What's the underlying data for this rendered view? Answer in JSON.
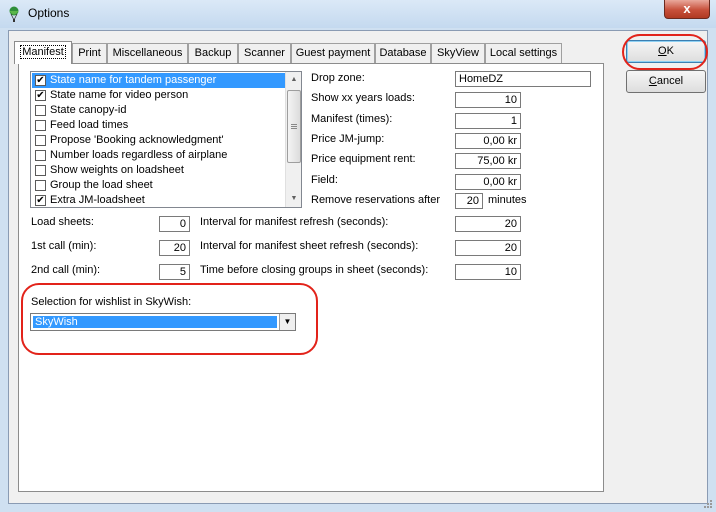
{
  "window": {
    "title": "Options",
    "close_glyph": "x"
  },
  "tabs": [
    {
      "label": "Manifest",
      "active": true
    },
    {
      "label": "Print"
    },
    {
      "label": "Miscellaneous"
    },
    {
      "label": "Backup"
    },
    {
      "label": "Scanner"
    },
    {
      "label": "Guest payment"
    },
    {
      "label": "Database"
    },
    {
      "label": "SkyView"
    },
    {
      "label": "Local settings"
    }
  ],
  "options_list": [
    {
      "label": "State name for tandem passenger",
      "checked": true,
      "selected": true
    },
    {
      "label": "State name for video person",
      "checked": true
    },
    {
      "label": "State canopy-id",
      "checked": false
    },
    {
      "label": "Feed load times",
      "checked": false
    },
    {
      "label": "Propose 'Booking acknowledgment'",
      "checked": false
    },
    {
      "label": "Number loads regardless of airplane",
      "checked": false
    },
    {
      "label": "Show weights on loadsheet",
      "checked": false
    },
    {
      "label": "Group the load sheet",
      "checked": false
    },
    {
      "label": "Extra JM-loadsheet",
      "checked": true
    }
  ],
  "right_fields": [
    {
      "label": "Drop zone:",
      "value": "HomeDZ"
    },
    {
      "label": "Show xx years loads:",
      "value": "10"
    },
    {
      "label": "Manifest (times):",
      "value": "1"
    },
    {
      "label": "Price JM-jump:",
      "value": "0,00 kr"
    },
    {
      "label": "Price equipment rent:",
      "value": "75,00 kr"
    },
    {
      "label": "Field:",
      "value": "0,00 kr"
    },
    {
      "label": "Remove reservations after",
      "value": "20",
      "suffix": "minutes"
    }
  ],
  "left_fields": [
    {
      "label": "Load sheets:",
      "value": "0"
    },
    {
      "label": "1st call (min):",
      "value": "20"
    },
    {
      "label": "2nd call (min):",
      "value": "5"
    }
  ],
  "mid_fields": [
    {
      "label": "Interval for manifest refresh (seconds):",
      "value": "20"
    },
    {
      "label": "Interval for manifest sheet refresh (seconds):",
      "value": "20"
    },
    {
      "label": "Time before closing groups in sheet (seconds):",
      "value": "10"
    }
  ],
  "wishlist": {
    "label": "Selection for wishlist in SkyWish:",
    "value": "SkyWish"
  },
  "buttons": {
    "ok_label": "OK",
    "ok_accel": "O",
    "ok_rest": "K",
    "cancel_label": "Cancel",
    "cancel_accel": "C",
    "cancel_rest": "ancel"
  },
  "colors": {
    "annotation": "#e2231a",
    "selection": "#3399ff"
  }
}
